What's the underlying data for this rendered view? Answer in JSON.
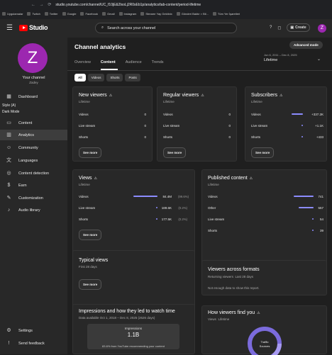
{
  "browser": {
    "url": "studio.youtube.com/channel/UC_f10jE&2lxoLj2R0sEb1p/analytics/tab-content/period-lifetime",
    "bookmarks": [
      "Uygulamalar",
      "Twitch",
      "Twitter",
      "Google",
      "Facebook",
      "Gmail",
      "Instagram",
      "Streamr Yay Geldinix",
      "Gönderi Baktır > Bil...",
      "Tüm Yer İşaretleri"
    ]
  },
  "topbar": {
    "logo_text": "Studio",
    "search_placeholder": "Search across your channel",
    "create_label": "Create",
    "avatar_letter": "Z"
  },
  "sidebar": {
    "avatar_letter": "Z",
    "channel_label": "Your channel",
    "channel_name": "Zadey",
    "style_label": "Style (A)",
    "dark_label": "Dark Mode",
    "items": [
      {
        "label": "Dashboard",
        "icon": "dashboard-icon"
      },
      {
        "label": "Content",
        "icon": "content-icon"
      },
      {
        "label": "Analytics",
        "icon": "analytics-icon"
      },
      {
        "label": "Community",
        "icon": "community-icon"
      },
      {
        "label": "Languages",
        "icon": "languages-icon"
      },
      {
        "label": "Content detection",
        "icon": "content-detection-icon"
      },
      {
        "label": "Earn",
        "icon": "earn-icon"
      },
      {
        "label": "Customization",
        "icon": "customization-icon"
      },
      {
        "label": "Audio library",
        "icon": "audio-library-icon"
      }
    ],
    "bottom": [
      {
        "label": "Settings",
        "icon": "settings-icon"
      },
      {
        "label": "Send feedback",
        "icon": "feedback-icon"
      }
    ]
  },
  "main": {
    "title": "Channel analytics",
    "advanced_label": "Advanced mode",
    "date_range": "Jun 6, 2011 – Dec 8, 2025",
    "date_label": "Lifetime",
    "tabs": [
      "Overview",
      "Content",
      "Audience",
      "Trends"
    ],
    "chips": [
      "All",
      "Videos",
      "Shorts",
      "Posts"
    ],
    "see_more": "See more",
    "new_viewers": {
      "title": "New viewers",
      "sub": "Lifetime",
      "rows": [
        {
          "label": "Videos",
          "value": "0"
        },
        {
          "label": "Live stream",
          "value": "0"
        },
        {
          "label": "Shorts",
          "value": "0"
        }
      ]
    },
    "regular_viewers": {
      "title": "Regular viewers",
      "sub": "Lifetime",
      "rows": [
        {
          "label": "Videos",
          "value": "0"
        },
        {
          "label": "Live stream",
          "value": "0"
        },
        {
          "label": "Shorts",
          "value": "0"
        }
      ]
    },
    "subscribers": {
      "title": "Subscribers",
      "sub": "Lifetime",
      "rows": [
        {
          "label": "Videos",
          "value": "+337.2K",
          "share": 0.99
        },
        {
          "label": "Live stream",
          "value": "+1.1K",
          "share": 0.01
        },
        {
          "label": "Shorts",
          "value": "+433",
          "share": 0.01
        }
      ]
    },
    "views": {
      "title": "Views",
      "sub": "Lifetime",
      "rows": [
        {
          "label": "Videos",
          "value": "84.4M",
          "pct": "(99.6%)",
          "share": 0.996
        },
        {
          "label": "Live stream",
          "value": "189.6K",
          "pct": "(0.2%)",
          "share": 0.002
        },
        {
          "label": "Shorts",
          "value": "177.5K",
          "pct": "(0.2%)",
          "share": 0.002
        }
      ]
    },
    "published": {
      "title": "Published content",
      "sub": "Lifetime",
      "rows": [
        {
          "label": "Videos",
          "value": "741",
          "share": 1.0
        },
        {
          "label": "Other",
          "value": "557",
          "share": 0.75
        },
        {
          "label": "Live stream",
          "value": "54",
          "share": 0.07
        },
        {
          "label": "Shorts",
          "value": "39",
          "share": 0.05
        }
      ]
    },
    "typical_views": {
      "title": "Typical views",
      "sub": "First 28 days"
    },
    "viewers_formats": {
      "title": "Viewers across formats",
      "sub_a": "Returning viewers",
      "sub_b": "Last 28 days",
      "empty": "Not enough data to show this report."
    },
    "impressions": {
      "title": "Impressions and how they led to watch time",
      "sub": "Data available Oct 1, 2018 – Dec 8, 2025 (2626 days)",
      "box_label": "Impressions",
      "box_value": "1.1B",
      "footnote": "83.6% from YouTube recommending your content"
    },
    "how_find": {
      "title": "How viewers find you",
      "sub_a": "Views",
      "sub_b": "Lifetime",
      "donut_label_a": "Traffic",
      "donut_label_b": "Sources"
    }
  },
  "colors": {
    "accent": "#8c8cff",
    "avatar": "#9c27b0",
    "brand": "#ff0000"
  }
}
